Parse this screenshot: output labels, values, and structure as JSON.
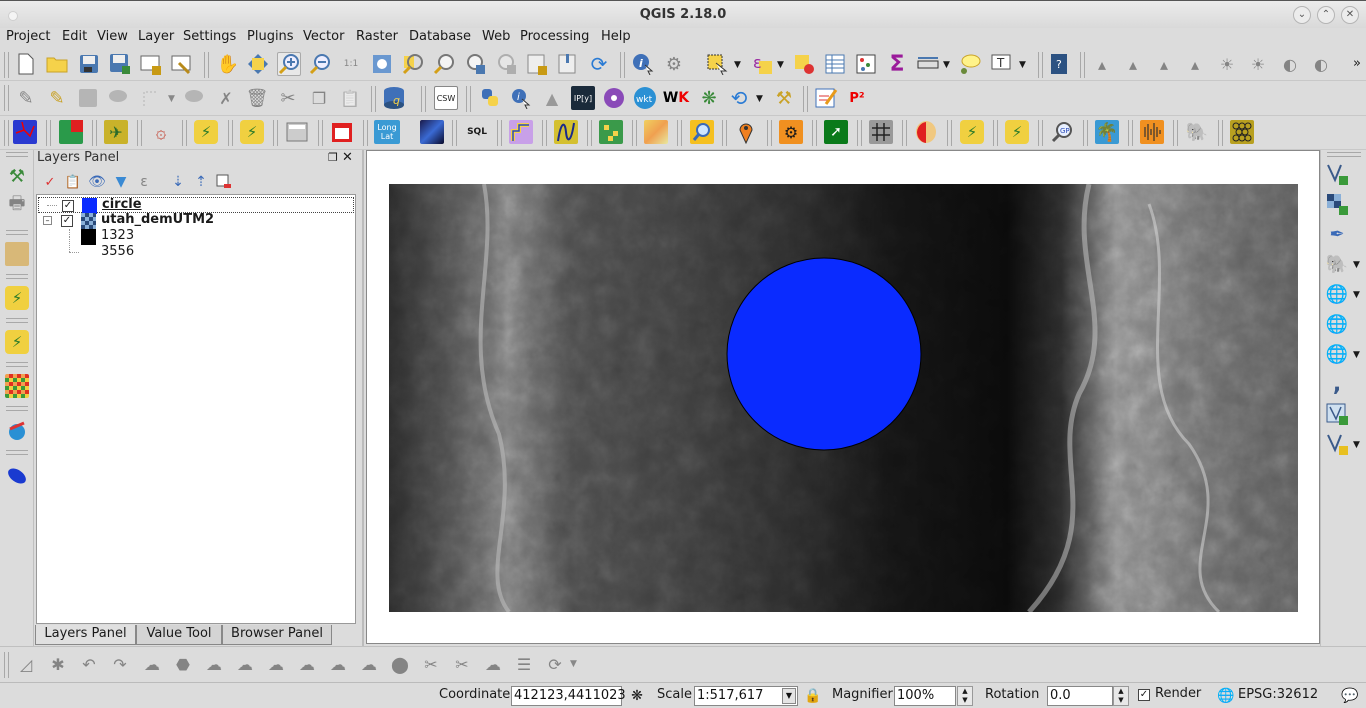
{
  "window": {
    "title": "QGIS 2.18.0",
    "controls": [
      "minimize",
      "maximize",
      "close"
    ]
  },
  "menubar": [
    "Project",
    "Edit",
    "View",
    "Layer",
    "Settings",
    "Plugins",
    "Vector",
    "Raster",
    "Database",
    "Web",
    "Processing",
    "Help"
  ],
  "toolbars": {
    "file": [
      "new-project-icon",
      "open-project-icon",
      "save-project-icon",
      "save-as-icon",
      "new-print-composer-icon",
      "composer-manager-icon"
    ],
    "navigation": [
      "pan-icon",
      "pan-to-selection-icon",
      "zoom-in-icon",
      "zoom-out-icon",
      "zoom-native-icon",
      "zoom-full-icon",
      "zoom-to-selection-icon",
      "zoom-to-layer-icon",
      "zoom-last-icon",
      "zoom-next-icon",
      "new-bookmark-icon",
      "show-bookmarks-icon",
      "refresh-icon"
    ],
    "attributes": [
      "identify-icon",
      "run-action-icon",
      "select-features-icon",
      "select-expression-icon",
      "deselect-icon",
      "attribute-table-icon",
      "field-calculator-icon",
      "statistics-icon",
      "measure-icon",
      "map-tips-icon",
      "text-annotation-icon"
    ],
    "help": [
      "whats-this-icon"
    ],
    "raster": [
      "histogram-stretch-icon",
      "local-histogram-icon",
      "cumulative-cut-icon",
      "local-cumulative-icon",
      "increase-brightness-icon",
      "decrease-brightness-icon",
      "increase-contrast-icon",
      "decrease-contrast-icon"
    ],
    "overflow": "»",
    "digitizing": [
      "current-edits-icon",
      "toggle-editing-icon",
      "save-edits-icon",
      "add-feature-icon",
      "node-tool-icon",
      "move-feature-icon",
      "delete-selected-icon",
      "cut-icon",
      "copy-icon",
      "paste-icon"
    ],
    "database": [
      "db-manager-icon"
    ],
    "web": [
      "csw-icon"
    ],
    "plugins": [
      "python-console-icon",
      "identify-plus-icon",
      "terrain-icon",
      "ipython-icon",
      "plugin-settings-icon",
      "wkt-icon",
      "quick-wkt-icon",
      "plugin-reloader-icon",
      "undo-icon",
      "build-icon"
    ],
    "misc": [
      "sketch-icon",
      "p2-icon"
    ],
    "p2_label": "P²",
    "plugins_row3": [
      "network-icon",
      "color-icon",
      "satellite-icon",
      "spiral-icon",
      "plugin-a-icon",
      "plugin-b-icon",
      "calc-icon",
      "calendar-icon",
      "longlat-icon",
      "space-icon",
      "sql-icon",
      "profile-icon",
      "curve-icon",
      "grid-icon",
      "map-icon",
      "search-icon",
      "pin-icon",
      "gears-icon",
      "green-map-icon",
      "warp-icon",
      "palette-icon",
      "plugin-c-icon",
      "plugin-d-icon",
      "geo-search-icon",
      "tree-icon",
      "spectrum-icon",
      "elephant-icon",
      "hex-icon"
    ],
    "longlat_label": [
      "Long",
      "Lat"
    ]
  },
  "left_toolbar": [
    "gps-icon",
    "print-icon",
    "treasure-map-icon",
    "plugin-e-icon",
    "plugin-f-icon",
    "heatmap-icon",
    "processing-icon",
    "mouse-icon"
  ],
  "layers_panel": {
    "title": "Layers Panel",
    "tools": [
      "style-icon",
      "add-group-icon",
      "visibility-icon",
      "filter-icon",
      "expression-filter-icon",
      "expand-icon",
      "collapse-icon",
      "remove-icon"
    ],
    "layers": [
      {
        "name": "circle",
        "visible": true,
        "color": "#0a2bff",
        "selected": true
      },
      {
        "name": "utah_demUTM2",
        "visible": true,
        "expanded": true,
        "legend": [
          {
            "label": "1323",
            "color": "#000000"
          },
          {
            "label": "3556",
            "color": "#ffffff"
          }
        ]
      }
    ]
  },
  "bottom_tabs": [
    "Layers Panel",
    "Value Tool",
    "Browser Panel"
  ],
  "right_toolbar": [
    "add-vector-icon",
    "add-raster-icon",
    "add-spatialite-icon",
    "add-postgis-icon",
    "add-wms-icon",
    "add-wcs-icon",
    "add-wfs-icon",
    "add-delimited-icon",
    "add-virtual-icon",
    "new-layer-icon"
  ],
  "advanced_digitizing": [
    "measure-tool-icon",
    "snapping-icon",
    "undo-icon",
    "redo-icon",
    "rotate-feature-icon",
    "simplify-icon",
    "add-ring-icon",
    "add-part-icon",
    "fill-ring-icon",
    "delete-ring-icon",
    "delete-part-icon",
    "reshape-icon",
    "offset-curve-icon",
    "split-features-icon",
    "split-parts-icon",
    "merge-icon",
    "merge-attributes-icon",
    "rotate-label-icon"
  ],
  "map": {
    "circle_color": "#0a2bff"
  },
  "statusbar": {
    "coordinate_label": "Coordinate",
    "coordinate": "412123,4411023",
    "scale_label": "Scale",
    "scale": "1:517,617",
    "magnifier_label": "Magnifier",
    "magnifier": "100%",
    "rotation_label": "Rotation",
    "rotation": "0.0",
    "render_label": "Render",
    "render_checked": true,
    "crs": "EPSG:32612"
  }
}
